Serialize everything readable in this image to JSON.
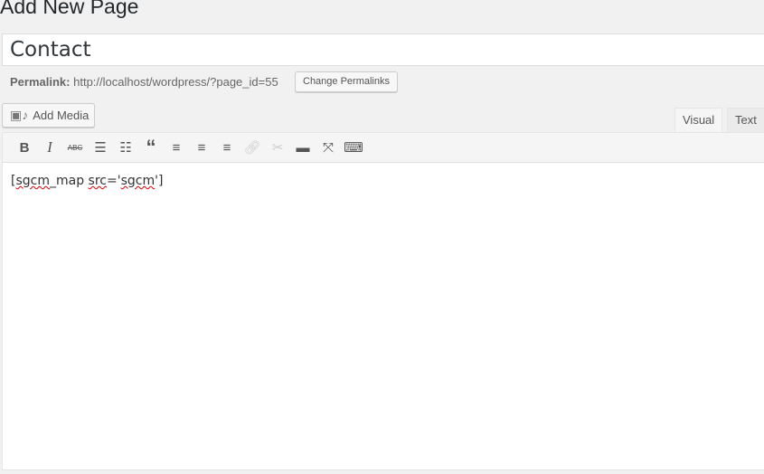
{
  "page_title": "Add New Page",
  "post_title": "Contact",
  "permalink": {
    "label": "Permalink:",
    "url": "http://localhost/wordpress/?page_id=55",
    "button": "Change Permalinks"
  },
  "add_media": "Add Media",
  "tabs": {
    "visual": "Visual",
    "text": "Text"
  },
  "toolbar": [
    "bold",
    "italic",
    "strikethrough",
    "bullet-list",
    "numbered-list",
    "blockquote",
    "align-left",
    "align-center",
    "align-right",
    "link",
    "unlink",
    "read-more",
    "fullscreen",
    "toolbar-toggle"
  ],
  "content": {
    "p1": "[",
    "w1": "sgcm",
    "p2": "_map ",
    "w2": "src",
    "p3": "='",
    "w3": "sgcm",
    "p4": "']"
  }
}
